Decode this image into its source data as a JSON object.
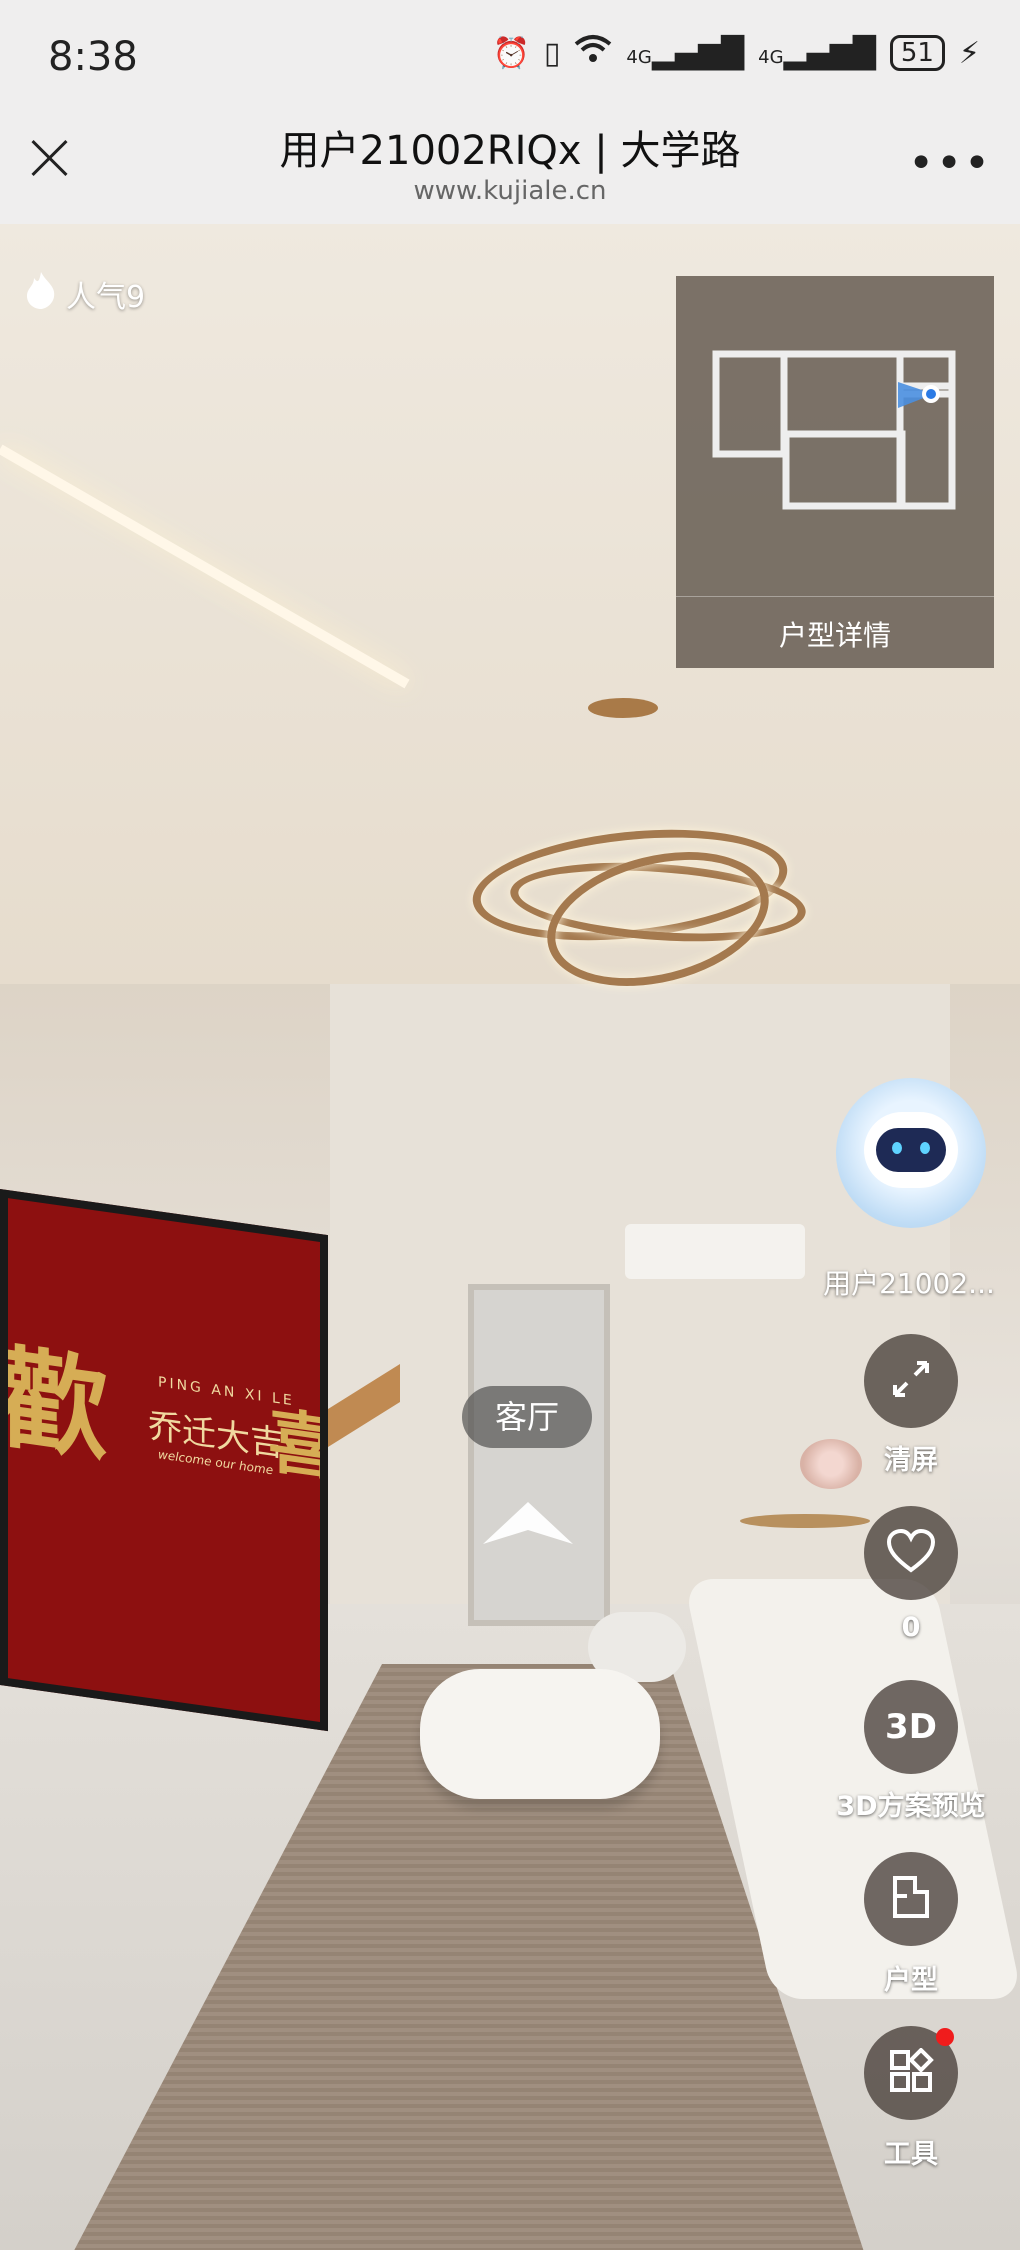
{
  "status_bar": {
    "time": "8:38",
    "network_1": "4G",
    "network_2": "4G",
    "battery": "51"
  },
  "header": {
    "title": "用户21002RIQx | 大学路",
    "url": "www.kujiale.cn",
    "more_label": "•••"
  },
  "viewer": {
    "popularity": "人气9",
    "minimap_label": "户型详情",
    "room_tag": "客厅",
    "tv_text_left": "歡",
    "tv_text_right": "喜",
    "tv_pingan": "PING AN XI LE",
    "tv_blessing": "乔迁大吉",
    "tv_welcome": "welcome our home"
  },
  "right_rail": {
    "avatar_name": "用户21002...",
    "fullscreen_label": "清屏",
    "like_count": "0",
    "preview3d_icon": "3D",
    "preview3d_label": "3D方案预览",
    "floorplan_label": "户型",
    "tools_label": "工具"
  },
  "icons": {
    "close": "close-icon",
    "more": "more-icon",
    "flame": "flame-icon",
    "expand": "expand-icon",
    "heart": "heart-icon",
    "rotate3d": "rotate-3d-icon",
    "floorplan": "floorplan-icon",
    "tools": "tools-icon"
  },
  "colors": {
    "status_bg": "#efeeee",
    "badge_red": "#f01c1c",
    "tv_red": "#8d1010",
    "gold": "#d6ad55"
  }
}
